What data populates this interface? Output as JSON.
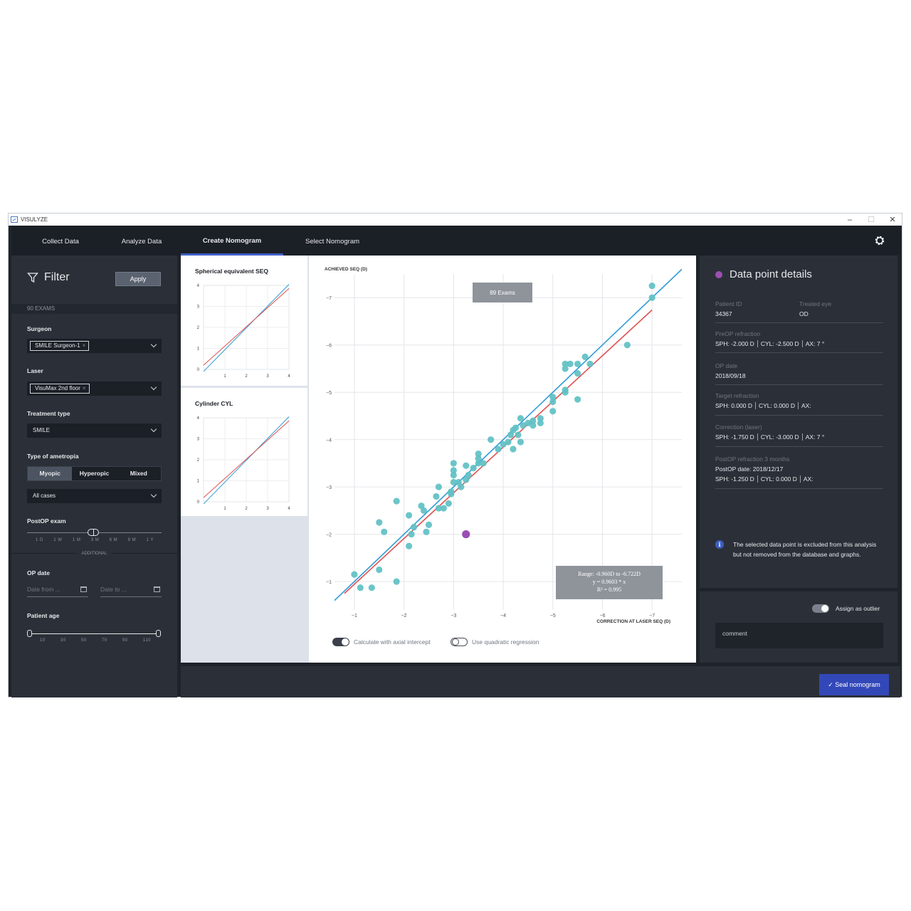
{
  "window": {
    "title": "VISULYZE",
    "minimize_glyph": "–",
    "maximize_glyph": "☐",
    "close_glyph": "✕"
  },
  "nav": {
    "tabs": [
      {
        "label": "Collect Data"
      },
      {
        "label": "Analyze Data"
      },
      {
        "label": "Create Nomogram"
      },
      {
        "label": "Select Nomogram"
      }
    ],
    "active_tab": "Create Nomogram",
    "settings_icon": "gear-icon"
  },
  "filter": {
    "title": "Filter",
    "apply_label": "Apply",
    "exam_count": "90 EXAMS",
    "surgeon": {
      "label": "Surgeon",
      "chip": "SMILE Surgeon-1",
      "chip_remove": "×"
    },
    "laser": {
      "label": "Laser",
      "chip": "VisuMax 2nd floor",
      "chip_remove": "×"
    },
    "treatment": {
      "label": "Treatment type",
      "value": "SMILE"
    },
    "ametropia": {
      "label": "Type of ametropia",
      "options": [
        "Myopic",
        "Hyperopic",
        "Mixed"
      ],
      "selected": "Myopic",
      "cases_value": "All cases"
    },
    "postop": {
      "label": "PostOP exam",
      "ticks": [
        "1 D",
        "1 W",
        "1 M",
        "3 M",
        "6 M",
        "9 M",
        "1 Y"
      ],
      "selected": "3 M",
      "additional_label": "ADDITIONAL"
    },
    "op_date": {
      "label": "OP date",
      "from_placeholder": "Date from ...",
      "to_placeholder": "Date to ..."
    },
    "patient_age": {
      "label": "Patient age",
      "ticks": [
        "10",
        "30",
        "50",
        "70",
        "90",
        "110"
      ],
      "range": [
        10,
        110
      ]
    }
  },
  "thumbnails": [
    {
      "title": "Spherical equivalent SEQ",
      "x_ticks": [
        "1",
        "2",
        "3",
        "4"
      ],
      "y_ticks": [
        "0",
        "1",
        "2",
        "3",
        "4"
      ]
    },
    {
      "title": "Cylinder CYL",
      "x_ticks": [
        "1",
        "2",
        "3",
        "4"
      ],
      "y_ticks": [
        "0",
        "1",
        "2",
        "3",
        "4"
      ]
    }
  ],
  "colors": {
    "accent": "#3f5ec4",
    "point": "#5fc0c4",
    "selected_point": "#9a4fb1",
    "line_blue": "#2e9bd6",
    "line_red": "#e05050"
  },
  "chart_data": {
    "type": "scatter",
    "ylabel": "ACHIEVED SEQ (D)",
    "xlabel": "CORRECTION AT LASER SEQ (D)",
    "x_range": [
      -0.6,
      -7.6
    ],
    "y_range": [
      -0.4,
      -7.5
    ],
    "x_ticks": [
      -1,
      -2,
      -3,
      -4,
      -5,
      -6,
      -7
    ],
    "y_ticks": [
      -1,
      -2,
      -3,
      -4,
      -5,
      -6,
      -7
    ],
    "x_tick_labels": [
      "−1",
      "−2",
      "−3",
      "−4",
      "−5",
      "−6",
      "−7"
    ],
    "y_tick_labels": [
      "−1",
      "−2",
      "−3",
      "−4",
      "−5",
      "−6",
      "−7"
    ],
    "grid": true,
    "exam_badge": "89 Exams",
    "stats_box": [
      "Range: -0.960D to -6.722D",
      "y = 0.9603 * x",
      "R² = 0.995"
    ],
    "series": [
      {
        "points": [
          [
            -1.0,
            -1.15
          ],
          [
            -1.12,
            -0.87
          ],
          [
            -1.35,
            -0.87
          ],
          [
            -1.5,
            -1.25
          ],
          [
            -1.5,
            -2.25
          ],
          [
            -1.6,
            -2.05
          ],
          [
            -1.85,
            -1.0
          ],
          [
            -1.85,
            -2.7
          ],
          [
            -2.1,
            -2.4
          ],
          [
            -2.1,
            -1.75
          ],
          [
            -2.15,
            -2.0
          ],
          [
            -2.2,
            -2.15
          ],
          [
            -2.35,
            -2.6
          ],
          [
            -2.4,
            -2.5
          ],
          [
            -2.45,
            -2.05
          ],
          [
            -2.5,
            -2.2
          ],
          [
            -2.65,
            -2.8
          ],
          [
            -2.7,
            -2.55
          ],
          [
            -2.7,
            -3.0
          ],
          [
            -2.8,
            -2.55
          ],
          [
            -2.9,
            -2.65
          ],
          [
            -2.95,
            -2.9
          ],
          [
            -2.95,
            -2.85
          ],
          [
            -3.0,
            -3.25
          ],
          [
            -3.0,
            -3.1
          ],
          [
            -3.0,
            -3.35
          ],
          [
            -3.0,
            -3.5
          ],
          [
            -3.1,
            -3.1
          ],
          [
            -3.15,
            -3.0
          ],
          [
            -3.25,
            -3.15
          ],
          [
            -3.25,
            -3.45
          ],
          [
            -3.3,
            -3.25
          ],
          [
            -3.4,
            -3.4
          ],
          [
            -3.5,
            -3.5
          ],
          [
            -3.5,
            -3.6
          ],
          [
            -3.5,
            -3.7
          ],
          [
            -3.6,
            -3.5
          ],
          [
            -3.75,
            -4.0
          ],
          [
            -3.9,
            -3.8
          ],
          [
            -4.0,
            -3.9
          ],
          [
            -4.1,
            -3.95
          ],
          [
            -4.15,
            -4.1
          ],
          [
            -4.2,
            -3.8
          ],
          [
            -4.2,
            -4.2
          ],
          [
            -4.25,
            -4.25
          ],
          [
            -4.3,
            -4.1
          ],
          [
            -4.35,
            -3.95
          ],
          [
            -4.35,
            -4.45
          ],
          [
            -4.4,
            -4.3
          ],
          [
            -4.5,
            -4.35
          ],
          [
            -4.6,
            -4.4
          ],
          [
            -4.6,
            -4.3
          ],
          [
            -4.75,
            -4.45
          ],
          [
            -4.75,
            -4.35
          ],
          [
            -5.0,
            -4.9
          ],
          [
            -5.0,
            -4.6
          ],
          [
            -5.0,
            -4.8
          ],
          [
            -5.25,
            -5.05
          ],
          [
            -5.25,
            -5.0
          ],
          [
            -5.25,
            -5.5
          ],
          [
            -5.25,
            -5.6
          ],
          [
            -5.35,
            -5.6
          ],
          [
            -5.5,
            -5.6
          ],
          [
            -5.5,
            -5.4
          ],
          [
            -5.5,
            -4.85
          ],
          [
            -5.65,
            -5.75
          ],
          [
            -5.75,
            -5.6
          ],
          [
            -6.5,
            -6.0
          ],
          [
            -7.0,
            -7.25
          ],
          [
            -7.0,
            -7.0
          ]
        ]
      }
    ],
    "selected_point": [
      -3.25,
      -2.0
    ],
    "fit_lines": [
      {
        "color": "blue",
        "from": [
          -0.6,
          -0.6
        ],
        "to": [
          -7.6,
          -7.6
        ]
      },
      {
        "color": "red",
        "from": [
          -0.8,
          -0.75
        ],
        "to": [
          -7.0,
          -6.74
        ]
      }
    ]
  },
  "chart_controls": {
    "axial_intercept_label": "Calculate with axial intercept",
    "axial_intercept_on": true,
    "quadratic_label": "Use quadratic regression",
    "quadratic_on": false
  },
  "details": {
    "title": "Data point details",
    "patient_id_label": "Patient ID",
    "patient_id": "34367",
    "treated_eye_label": "Treated eye",
    "treated_eye": "OD",
    "preop_label": "PreOP refraction",
    "preop": [
      "SPH: -2.000 D",
      "CYL: -2.500 D",
      "AX: 7 °"
    ],
    "op_date_label": "OP date",
    "op_date": "2018/09/18",
    "target_label": "Target refraction",
    "target": [
      "SPH: 0.000 D",
      "CYL: 0.000 D",
      "AX:"
    ],
    "correction_label": "Correction (laser)",
    "correction": [
      "SPH: -1.750 D",
      "CYL: -3.000 D",
      "AX: 7 °"
    ],
    "postop_label": "PostOP refraction 3 months",
    "postop_date": "PostOP date: 2018/12/17",
    "postop": [
      "SPH: -1.250 D",
      "CYL: 0.000 D",
      "AX:"
    ],
    "info_glyph": "i",
    "info_text": "The selected data point is excluded from this analysis but not removed from the database and graphs."
  },
  "outlier": {
    "assign_label": "Assign as outlier",
    "assign_on": true,
    "comment_placeholder": "comment"
  },
  "footer": {
    "seal_label": "Seal nomogram",
    "seal_check": "✓"
  }
}
